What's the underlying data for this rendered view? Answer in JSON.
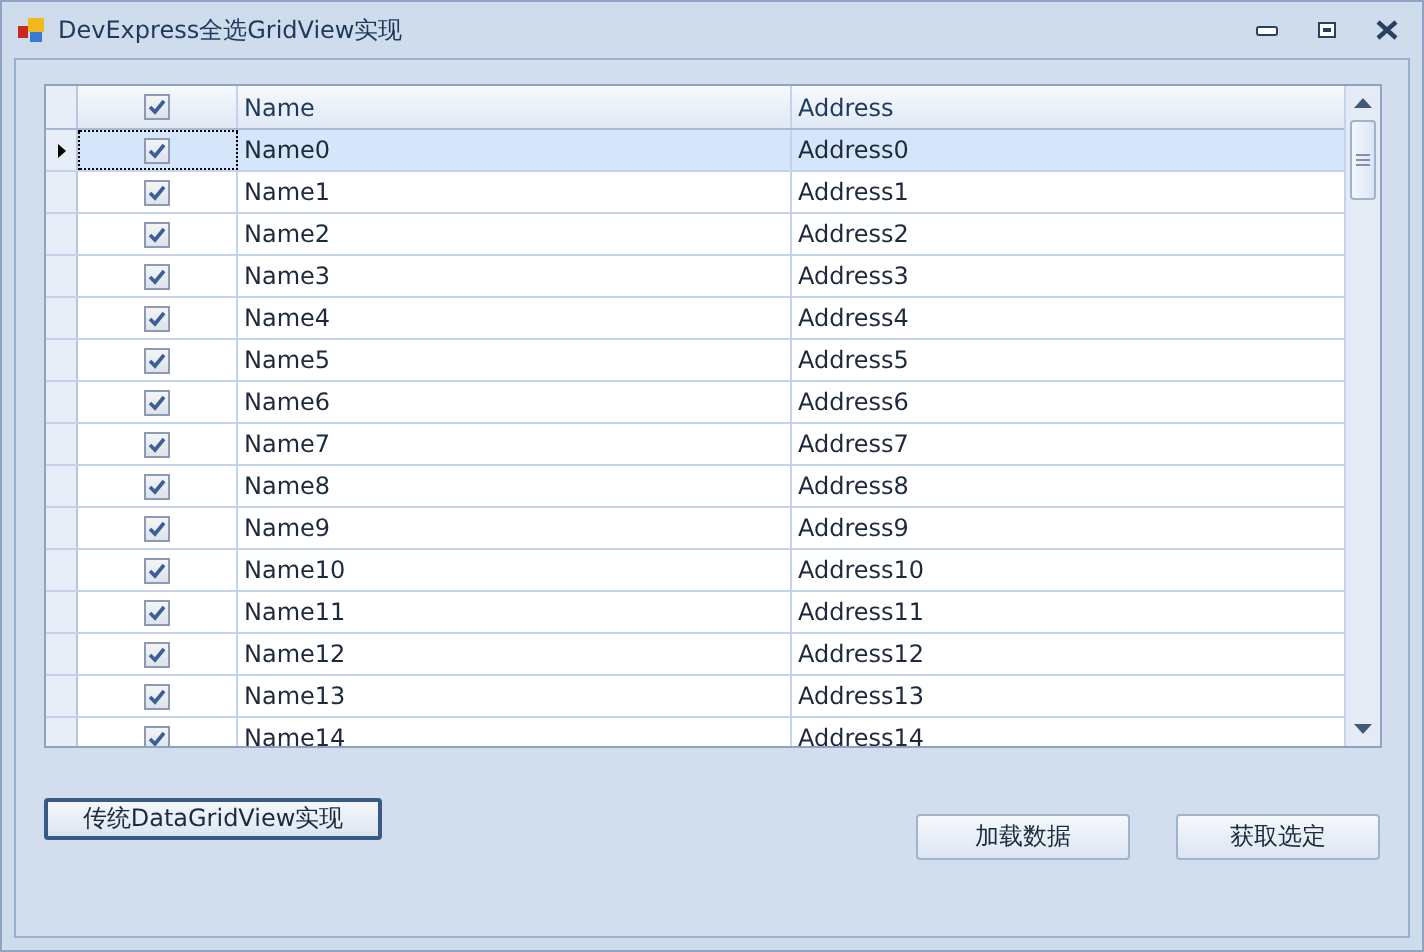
{
  "window": {
    "title": "DevExpress全选GridView实现"
  },
  "grid": {
    "header_checked": true,
    "columns": [
      "Name",
      "Address"
    ],
    "rows": [
      {
        "checked": true,
        "selected": true,
        "cells": [
          "Name0",
          "Address0"
        ]
      },
      {
        "checked": true,
        "selected": false,
        "cells": [
          "Name1",
          "Address1"
        ]
      },
      {
        "checked": true,
        "selected": false,
        "cells": [
          "Name2",
          "Address2"
        ]
      },
      {
        "checked": true,
        "selected": false,
        "cells": [
          "Name3",
          "Address3"
        ]
      },
      {
        "checked": true,
        "selected": false,
        "cells": [
          "Name4",
          "Address4"
        ]
      },
      {
        "checked": true,
        "selected": false,
        "cells": [
          "Name5",
          "Address5"
        ]
      },
      {
        "checked": true,
        "selected": false,
        "cells": [
          "Name6",
          "Address6"
        ]
      },
      {
        "checked": true,
        "selected": false,
        "cells": [
          "Name7",
          "Address7"
        ]
      },
      {
        "checked": true,
        "selected": false,
        "cells": [
          "Name8",
          "Address8"
        ]
      },
      {
        "checked": true,
        "selected": false,
        "cells": [
          "Name9",
          "Address9"
        ]
      },
      {
        "checked": true,
        "selected": false,
        "cells": [
          "Name10",
          "Address10"
        ]
      },
      {
        "checked": true,
        "selected": false,
        "cells": [
          "Name11",
          "Address11"
        ]
      },
      {
        "checked": true,
        "selected": false,
        "cells": [
          "Name12",
          "Address12"
        ]
      },
      {
        "checked": true,
        "selected": false,
        "cells": [
          "Name13",
          "Address13"
        ]
      },
      {
        "checked": true,
        "selected": false,
        "cells": [
          "Name14",
          "Address14"
        ]
      }
    ]
  },
  "buttons": [
    {
      "label": "传统DataGridView实现",
      "kind": "default"
    },
    {
      "label": "加载数据",
      "kind": "normal"
    },
    {
      "label": "获取选定",
      "kind": "normal"
    }
  ]
}
